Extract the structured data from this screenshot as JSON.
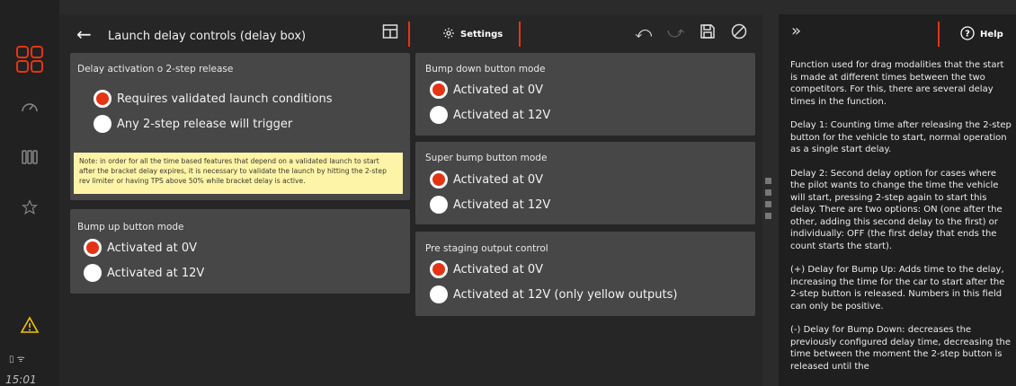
{
  "app": {
    "title": "Launch delay controls (delay box)",
    "settings_label": "Settings",
    "help_label": "Help",
    "clock": "15:01"
  },
  "cards": {
    "delay_activation": {
      "label": "Delay activation o 2-step release",
      "options": [
        "Requires validated launch conditions",
        "Any 2-step release will trigger"
      ],
      "selected": 0
    },
    "note": "Note: in order for all the time based features that depend on a validated launch to start after the bracket delay expires, it is necessary to validate the launch by hitting the 2-step rev limiter or having TPS above 50% while bracket delay is active.",
    "bump_up": {
      "label": "Bump up button mode",
      "options": [
        "Activated at 0V",
        "Activated at 12V"
      ],
      "selected": 0
    },
    "bump_down": {
      "label": "Bump down button mode",
      "options": [
        "Activated at 0V",
        "Activated at 12V"
      ],
      "selected": 0
    },
    "super_bump": {
      "label": "Super bump button mode",
      "options": [
        "Activated at 0V",
        "Activated at 12V"
      ],
      "selected": 0
    },
    "pre_staging": {
      "label": "Pre staging output control",
      "options": [
        "Activated at 0V",
        "Activated at 12V (only yellow outputs)"
      ],
      "selected": 0
    }
  },
  "help": {
    "paragraphs": [
      "Function used for drag modalities that the start is made at different times between the two competitors. For this, there are several delay times in the function.",
      "Delay 1: Counting time after releasing the 2-step button for the vehicle to start, normal operation as a single start delay.",
      "Delay 2: Second delay option for cases where the pilot wants to change the time the vehicle will start, pressing 2-step again to start this delay. There are two options: ON (one after the other, adding this second delay to the first) or individually: OFF (the first delay that ends the count starts the start).",
      "(+) Delay for Bump Up: Adds time to the delay, increasing the time for the car to start after the 2-step button is released. Numbers in this field can only be positive.",
      "(-) Delay for Bump Down: decreases the previously configured delay time, decreasing the time between the moment the 2-step button is released until the"
    ]
  },
  "colors": {
    "accent": "#e53414",
    "warning": "#f5c400"
  }
}
